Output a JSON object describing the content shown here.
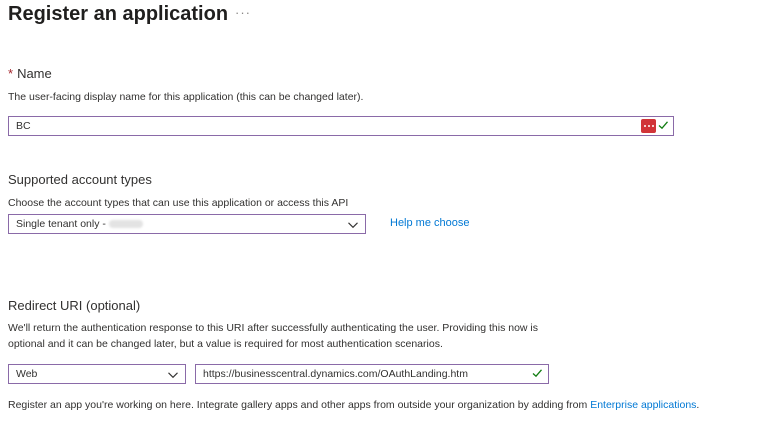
{
  "header": {
    "title": "Register an application",
    "more_icon": "more-horizontal-icon"
  },
  "name_section": {
    "required_marker": "*",
    "label": "Name",
    "description": "The user-facing display name for this application (this can be changed later).",
    "value": "BC"
  },
  "account_types": {
    "label": "Supported account types",
    "description": "Choose the account types that can use this application or access this API",
    "selected": "Single tenant only -",
    "help_link": "Help me choose"
  },
  "redirect": {
    "label": "Redirect URI (optional)",
    "description": "We'll return the authentication response to this URI after successfully authenticating the user. Providing this now is optional and it can be changed later, but a value is required for most authentication scenarios.",
    "platform": "Web",
    "uri": "https://businesscentral.dynamics.com/OAuthLanding.htm"
  },
  "footer": {
    "text": "Register an app you're working on here. Integrate gallery apps and other apps from outside your organization by adding from ",
    "link": "Enterprise applications",
    "suffix": "."
  },
  "colors": {
    "accent": "#0078d4",
    "input_border": "#8a6aa8",
    "valid_check": "#107c10",
    "warning_badge": "#d13438"
  }
}
